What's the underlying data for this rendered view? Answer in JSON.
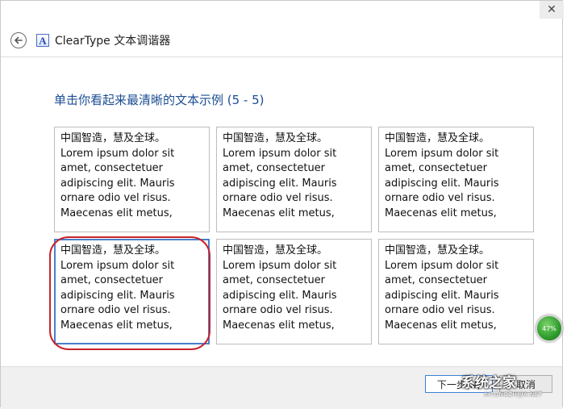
{
  "window": {
    "close_glyph": "✕"
  },
  "header": {
    "app_title": "ClearType 文本调谐器",
    "app_icon_letter": "A"
  },
  "instruction": "单击你看起来最清晰的文本示例 (5 - 5)",
  "samples": [
    {
      "lines": [
        "中国智造，慧及全球。",
        "Lorem ipsum dolor sit",
        "amet, consectetuer",
        "adipiscing elit. Mauris",
        "ornare odio vel risus.",
        "Maecenas elit metus,"
      ],
      "selected": false
    },
    {
      "lines": [
        "中国智造，慧及全球。",
        "Lorem ipsum dolor sit",
        "amet, consectetuer",
        "adipiscing elit. Mauris",
        "ornare odio vel risus.",
        "Maecenas elit metus,"
      ],
      "selected": false
    },
    {
      "lines": [
        "中国智造，慧及全球。",
        "Lorem ipsum dolor sit",
        "amet, consectetuer",
        "adipiscing elit. Mauris",
        "ornare odio vel risus.",
        "Maecenas elit metus,"
      ],
      "selected": false
    },
    {
      "lines": [
        "中国智造，慧及全球。",
        "Lorem ipsum dolor sit",
        "amet, consectetuer",
        "adipiscing elit. Mauris",
        "ornare odio vel risus.",
        "Maecenas elit metus,"
      ],
      "selected": true
    },
    {
      "lines": [
        "中国智造，慧及全球。",
        "Lorem ipsum dolor sit",
        "amet, consectetuer",
        "adipiscing elit. Mauris",
        "ornare odio vel risus.",
        "Maecenas elit metus,"
      ],
      "selected": false
    },
    {
      "lines": [
        "中国智造，慧及全球。",
        "Lorem ipsum dolor sit",
        "amet, consectetuer",
        "adipiscing elit. Mauris",
        "ornare odio vel risus.",
        "Maecenas elit metus,"
      ],
      "selected": false
    }
  ],
  "footer": {
    "next_label": "下一步(N)",
    "cancel_label": "取消"
  },
  "overlay": {
    "progress_percent": "47%",
    "watermark_text": "系统之家",
    "watermark_url": "XITONGZHIJIA.NET"
  },
  "colors": {
    "accent_blue": "#1b4c92",
    "selected_border": "#4a7fcb",
    "highlight_ring": "#c8232b",
    "progress_green": "#2e9c2c"
  }
}
